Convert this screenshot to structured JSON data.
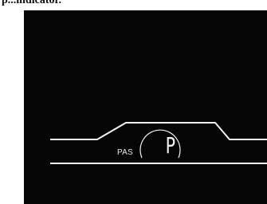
{
  "caption": {
    "text": "p...indicator."
  },
  "display": {
    "assist_label": "PAS",
    "assist_mode": "P"
  },
  "colors": {
    "panel": "#050505",
    "segment": "#f2f2f2",
    "page": "#ffffff"
  }
}
